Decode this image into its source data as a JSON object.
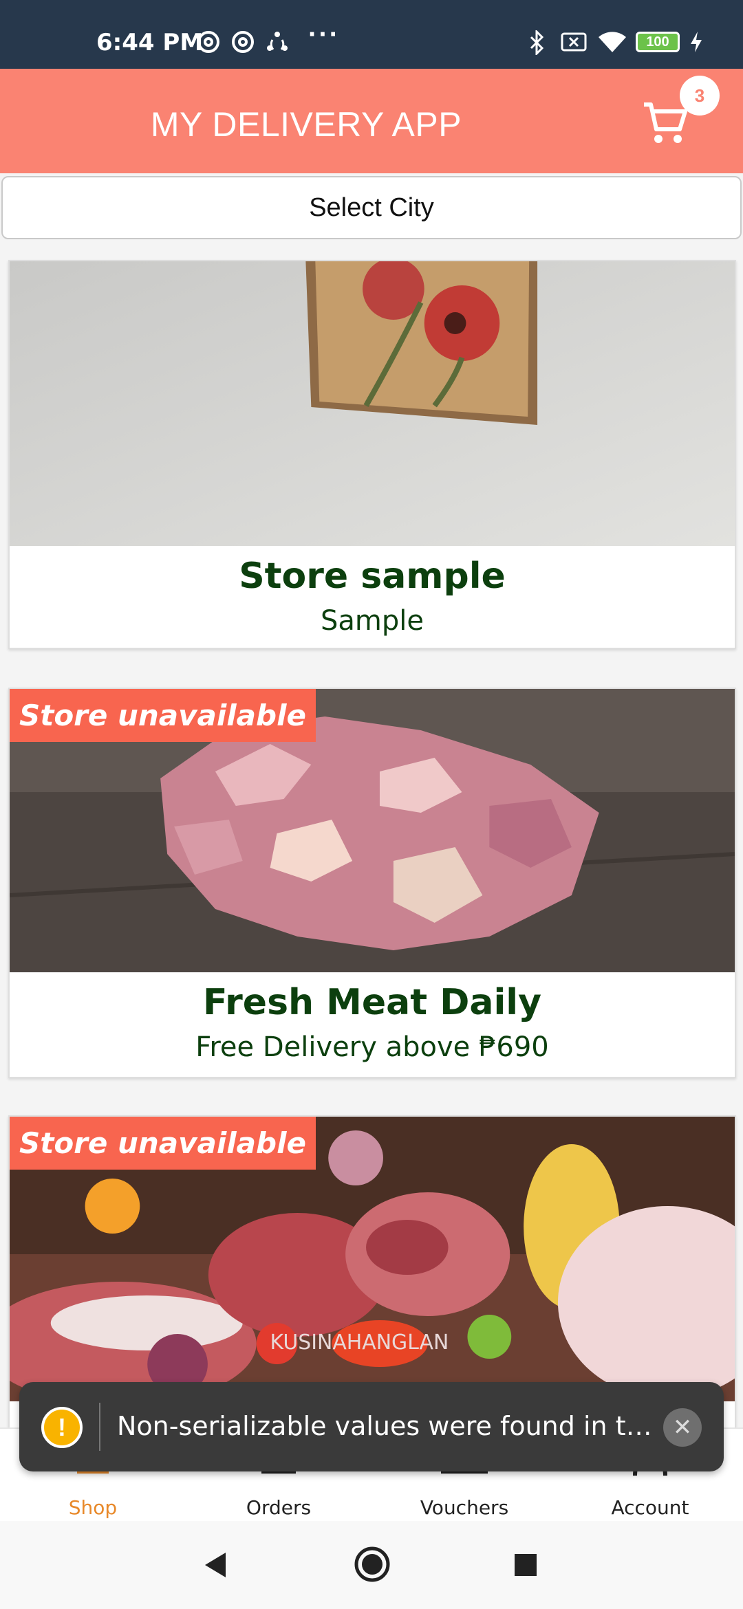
{
  "status_bar": {
    "time": "6:44 PM",
    "battery": "100",
    "icons": [
      "at-icon",
      "at-icon",
      "share-nodes-icon",
      "more-dots-icon",
      "bluetooth-icon",
      "no-sim-icon",
      "wifi-icon",
      "battery-icon",
      "charging-icon"
    ]
  },
  "header": {
    "title": "MY DELIVERY APP",
    "cart_count": "3"
  },
  "city_select": {
    "label": "Select City"
  },
  "stores": [
    {
      "title": "Store sample",
      "subtitle": "Sample",
      "unavailable": false
    },
    {
      "title": "Fresh Meat Daily",
      "subtitle": "Free Delivery above ₱690",
      "unavailable": true,
      "badge": "Store unavailable"
    },
    {
      "title": "",
      "subtitle": "",
      "unavailable": true,
      "badge": "Store unavailable",
      "image_watermark": "KUSINAHANGLAN"
    }
  ],
  "toast": {
    "message": "Non-serializable values were found in the n..."
  },
  "bottom_nav": {
    "items": [
      {
        "label": "Shop",
        "active": true
      },
      {
        "label": "Orders",
        "active": false
      },
      {
        "label": "Vouchers",
        "active": false
      },
      {
        "label": "Account",
        "active": false
      }
    ]
  },
  "colors": {
    "header": "#fa8372",
    "status_bar": "#27384c",
    "title_green": "#0c3f0e",
    "badge_red": "#f8654f",
    "active_nav": "#e8892a"
  }
}
